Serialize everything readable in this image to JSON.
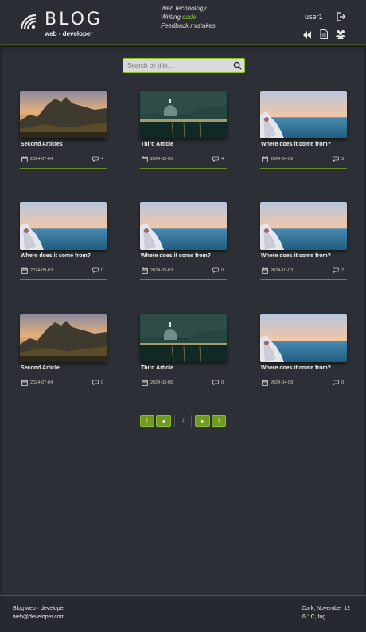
{
  "header": {
    "logo_title": "BLOG",
    "logo_subtitle": "web - developer",
    "tagline": [
      "Web technology",
      "Writing",
      "code",
      "Feedback mistakes"
    ],
    "username": "user1",
    "icons": [
      "logout-icon",
      "back-icon",
      "document-icon",
      "users-icon"
    ]
  },
  "search": {
    "placeholder": "Search by title..."
  },
  "articles": [
    {
      "title": "Second Articles",
      "date": "2024-07-04",
      "comments": "4",
      "image": "mountain-sunset"
    },
    {
      "title": "Third Article",
      "date": "2024-03-05",
      "comments": "4",
      "image": "city-night"
    },
    {
      "title": "Where does it come from?",
      "date": "2024-04-09",
      "comments": "3",
      "image": "sea-view"
    },
    {
      "title": "Where does it come from?",
      "date": "2024-09-03",
      "comments": "0",
      "image": "sea-view"
    },
    {
      "title": "Where does it come from?",
      "date": "2024-05-03",
      "comments": "0",
      "image": "sea-view"
    },
    {
      "title": "Where does it come from?",
      "date": "2024-10-03",
      "comments": "2",
      "image": "sea-view"
    },
    {
      "title": "Second Article",
      "date": "2024-07-04",
      "comments": "0",
      "image": "mountain-sunset"
    },
    {
      "title": "Third Article",
      "date": "2024-03-05",
      "comments": "0",
      "image": "city-night"
    },
    {
      "title": "Where does it come from?",
      "date": "2024-04-09",
      "comments": "0",
      "image": "sea-view"
    }
  ],
  "pagination": {
    "first": "[",
    "prev": "◀",
    "current": "1",
    "next": "▶",
    "last": "]"
  },
  "footer": {
    "brand": "Blog web  ·  developer",
    "email": "web@developer.com",
    "location_date": "Cork, November 12",
    "temp": "6",
    "deg_symbol": "°",
    "weather": "C, fog"
  },
  "colors": {
    "accent": "#8cbf26",
    "background": "#2c2f35"
  }
}
